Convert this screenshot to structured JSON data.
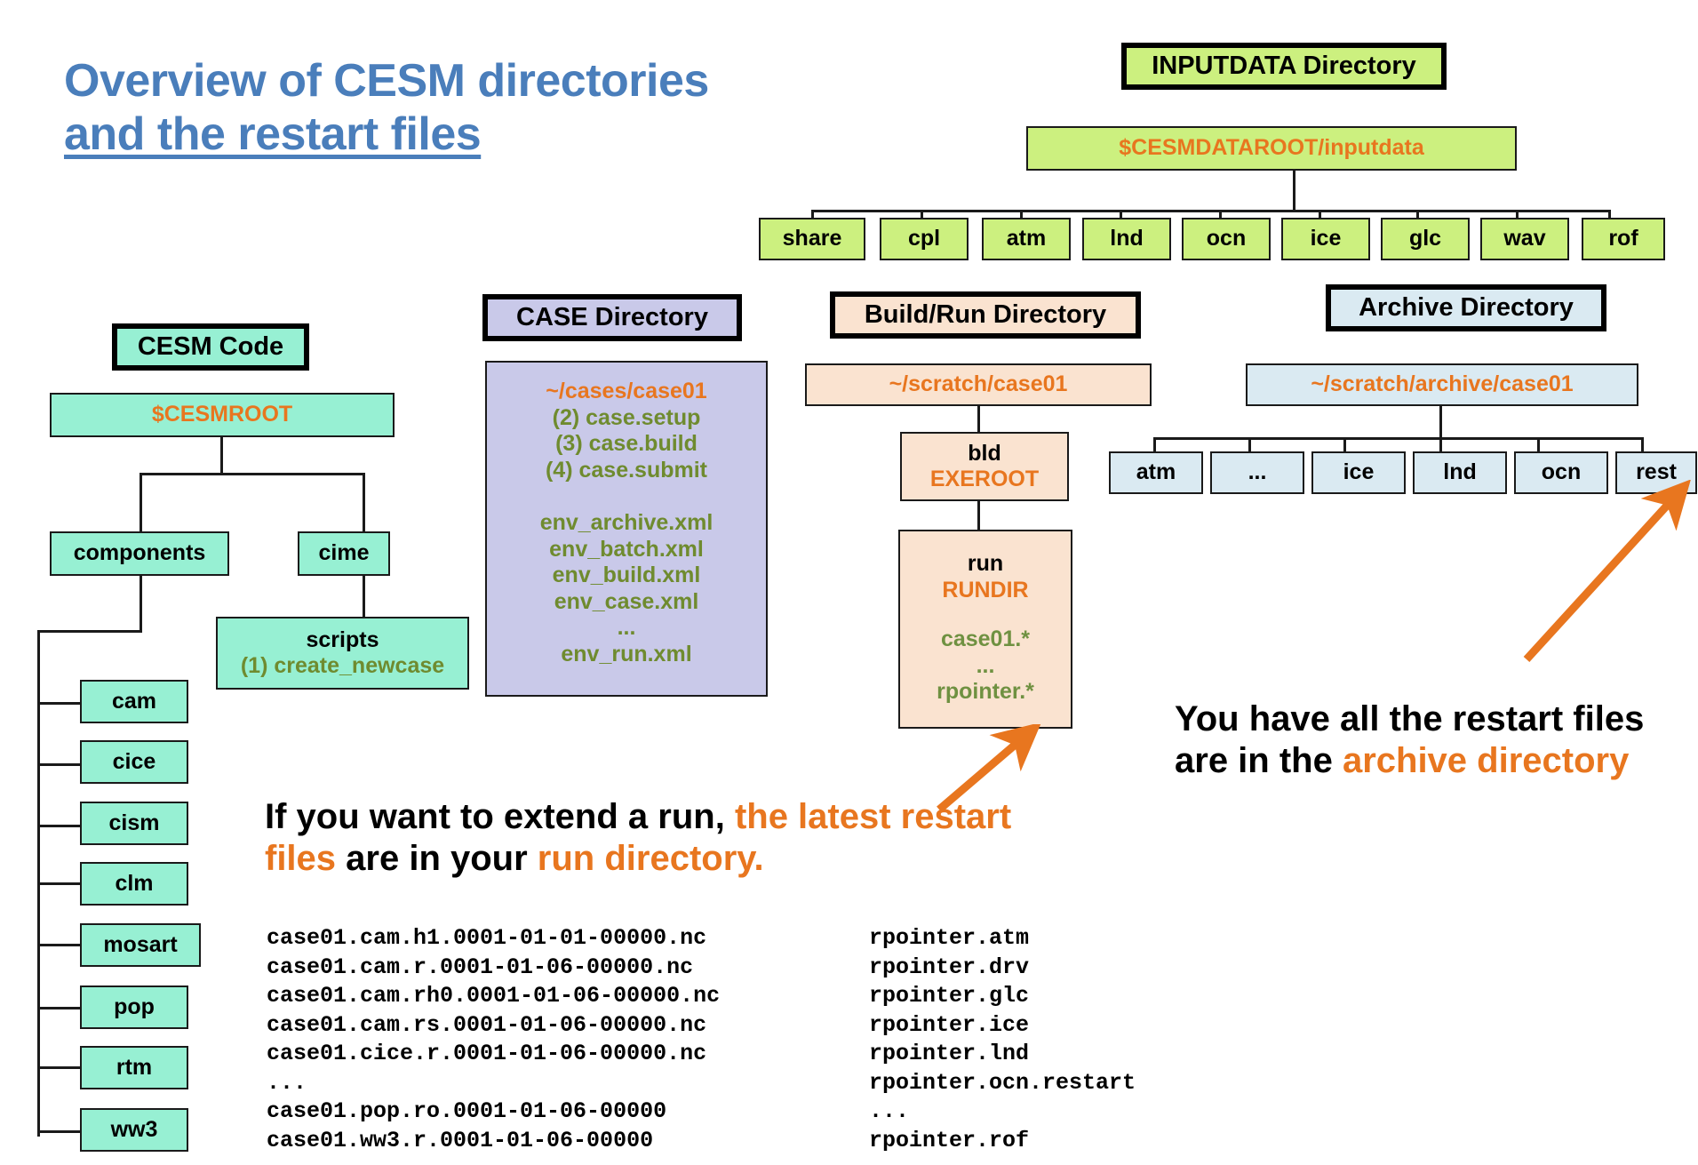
{
  "title": {
    "line1": "Overview of CESM directories",
    "line2": "and the restart files"
  },
  "colors": {
    "title_blue": "#4a7ebb",
    "accent_orange": "#e8761f",
    "olive_green": "#6f8b2f",
    "inputdata_green": "#ccf07f",
    "cesm_mint": "#97f0d3",
    "case_lavender": "#c9c9e9",
    "buildrun_peach": "#fae3d0",
    "archive_blue": "#daeaf2"
  },
  "inputdata": {
    "header": "INPUTDATA Directory",
    "root": "$CESMDATAROOT/inputdata",
    "children": [
      "share",
      "cpl",
      "atm",
      "lnd",
      "ocn",
      "ice",
      "glc",
      "wav",
      "rof"
    ]
  },
  "cesm_code": {
    "header": "CESM Code",
    "root": "$CESMROOT",
    "components_label": "components",
    "cime_label": "cime",
    "scripts_title": "scripts",
    "scripts_step": "(1) create_newcase",
    "components": [
      "cam",
      "cice",
      "cism",
      "clm",
      "mosart",
      "pop",
      "rtm",
      "ww3"
    ]
  },
  "case_dir": {
    "header": "CASE Directory",
    "path": "~/cases/case01",
    "steps": [
      "(2) case.setup",
      "(3) case.build",
      "(4) case.submit"
    ],
    "files": [
      "env_archive.xml",
      "env_batch.xml",
      "env_build.xml",
      "env_case.xml",
      "...",
      "env_run.xml"
    ]
  },
  "build_run_dir": {
    "header": "Build/Run Directory",
    "path": "~/scratch/case01",
    "bld": {
      "name": "bld",
      "var": "EXEROOT"
    },
    "run": {
      "name": "run",
      "var": "RUNDIR",
      "files": [
        "case01.*",
        "...",
        "rpointer.*"
      ]
    }
  },
  "archive_dir": {
    "header": "Archive Directory",
    "path": "~/scratch/archive/case01",
    "children": [
      "atm",
      "...",
      "ice",
      "lnd",
      "ocn",
      "rest"
    ]
  },
  "callouts": {
    "run": {
      "seg1": "If you want to extend a run, ",
      "seg2": "the latest restart files",
      "seg3": " are in your ",
      "seg4": "run directory."
    },
    "archive": {
      "seg1": "You have all the restart files are in the ",
      "seg2": "archive directory"
    }
  },
  "listings": {
    "case_files": "case01.cam.h1.0001-01-01-00000.nc\ncase01.cam.r.0001-01-06-00000.nc\ncase01.cam.rh0.0001-01-06-00000.nc\ncase01.cam.rs.0001-01-06-00000.nc\ncase01.cice.r.0001-01-06-00000.nc\n...\ncase01.pop.ro.0001-01-06-00000\ncase01.ww3.r.0001-01-06-00000",
    "rpointer_files": "rpointer.atm\nrpointer.drv\nrpointer.glc\nrpointer.ice\nrpointer.lnd\nrpointer.ocn.restart\n...\nrpointer.rof"
  }
}
